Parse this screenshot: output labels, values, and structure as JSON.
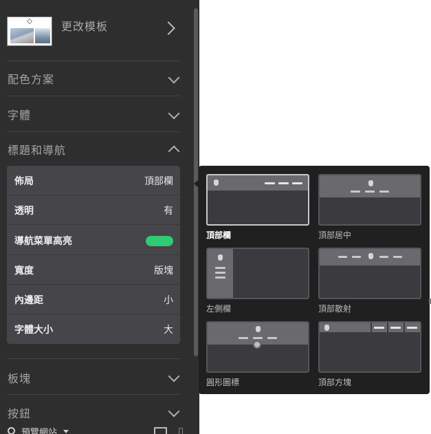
{
  "sidebar": {
    "template": {
      "label": "更改模板"
    },
    "sections": {
      "color_scheme": "配色方案",
      "fonts": "字體",
      "title_nav": "標題和導航",
      "blocks": "板塊",
      "buttons": "按鈕"
    },
    "settings": [
      {
        "label": "佈局",
        "value": "頂部欄"
      },
      {
        "label": "透明",
        "value": "有"
      },
      {
        "label": "導航菜單高亮",
        "value": "",
        "toggle": "on"
      },
      {
        "label": "寬度",
        "value": "版塊"
      },
      {
        "label": "內邊距",
        "value": "小"
      },
      {
        "label": "字體大小",
        "value": "大"
      }
    ],
    "bottom": {
      "preview_label": "預覽網站"
    }
  },
  "layout_options": [
    {
      "label": "頂部欄",
      "selected": true
    },
    {
      "label": "頂部居中",
      "selected": false
    },
    {
      "label": "左側欄",
      "selected": false
    },
    {
      "label": "頂部散射",
      "selected": false
    },
    {
      "label": "圓形圖標",
      "selected": false
    },
    {
      "label": "頂部方塊",
      "selected": false
    }
  ],
  "colors": {
    "sidebar_bg": "#2e2e2e",
    "panel_bg": "#45454a",
    "toggle_on": "#2ecc71",
    "flyout_bg": "#202020"
  },
  "icons": {
    "template_next": "chevron-right-icon",
    "section_toggle": "chevron-down-icon",
    "section_open": "chevron-up-icon",
    "preview": "search-icon",
    "desktop_view": "desktop-icon",
    "mobile_view": "mobile-icon"
  }
}
